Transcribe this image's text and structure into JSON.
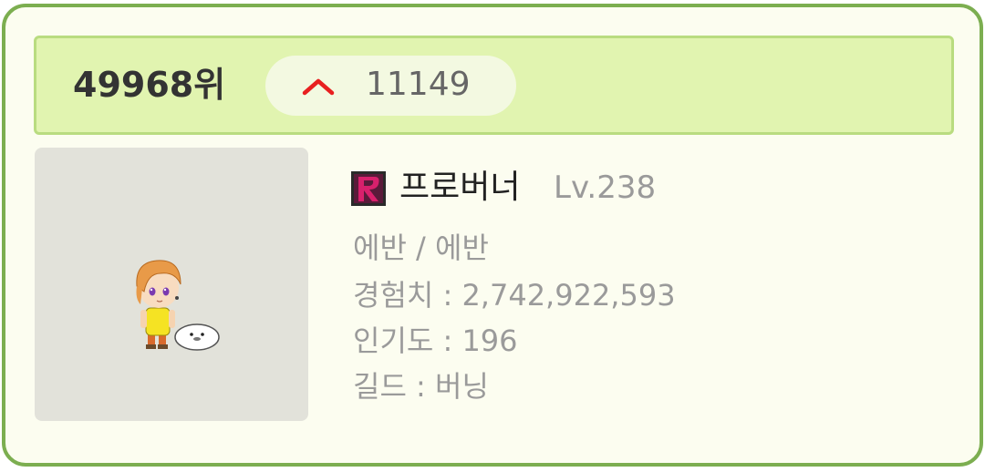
{
  "ranking": {
    "rank": "49968위",
    "change": {
      "direction": "up",
      "value": "11149",
      "arrow_color": "#e82020"
    }
  },
  "character": {
    "name": "프로버너",
    "level": "Lv.238",
    "world_job": "에반 / 에반",
    "exp": "경험치 : 2,742,922,593",
    "popularity": "인기도 : 196",
    "guild": "길드 : 버닝",
    "guild_icon": "guild-emblem-icon",
    "avatar": "character-avatar"
  },
  "colors": {
    "card_border": "#7cae50",
    "rank_bar_bg": "#e1f4b0",
    "avatar_bg": "#e2e2da"
  }
}
